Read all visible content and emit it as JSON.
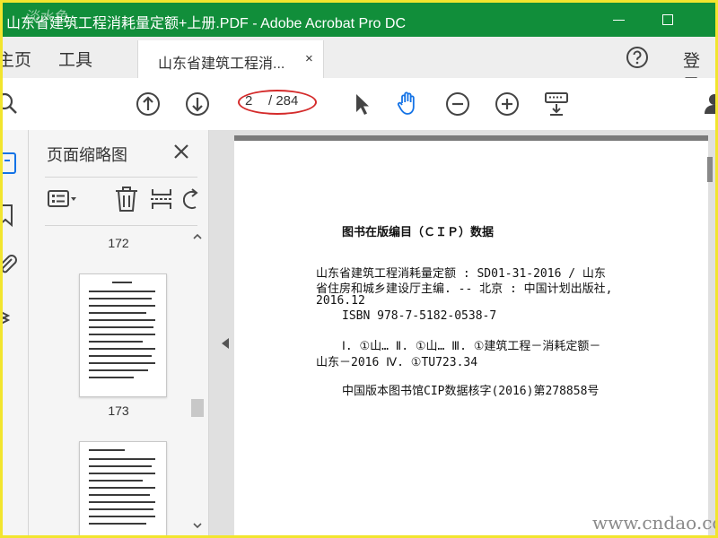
{
  "window": {
    "title": "山东省建筑工程消耗量定额+上册.PDF - Adobe Acrobat Pro DC"
  },
  "tabs": {
    "home": "主页",
    "tools": "工具",
    "document_tab": "山东省建筑工程消...",
    "close_symbol": "×",
    "login": "登录"
  },
  "toolbar": {
    "page_current": "2",
    "page_total": "/ 284"
  },
  "panel": {
    "title": "页面缩略图",
    "thumbnails": [
      {
        "label": "172"
      },
      {
        "label": "173"
      }
    ]
  },
  "document": {
    "cip_title": "图书在版编目（ＣＩＰ）数据",
    "lines": [
      "山东省建筑工程消耗量定额 : SD01-31-2016 / 山东",
      "省住房和城乡建设厅主编. -- 北京 : 中国计划出版社,",
      "2016.12",
      "ISBN 978-7-5182-0538-7",
      "Ⅰ. ①山… Ⅱ. ①山… Ⅲ. ①建筑工程－消耗定额－",
      "山东－2016 Ⅳ. ①TU723.34",
      "中国版本图书馆CIP数据核字(2016)第278858号"
    ]
  },
  "watermarks": {
    "top_left": "淡水鱼",
    "bottom_right": "www.cndao.com"
  },
  "colors": {
    "title_bar": "#118e3a",
    "highlight_ring": "#d42b2b",
    "accent_blue": "#1473e6"
  }
}
